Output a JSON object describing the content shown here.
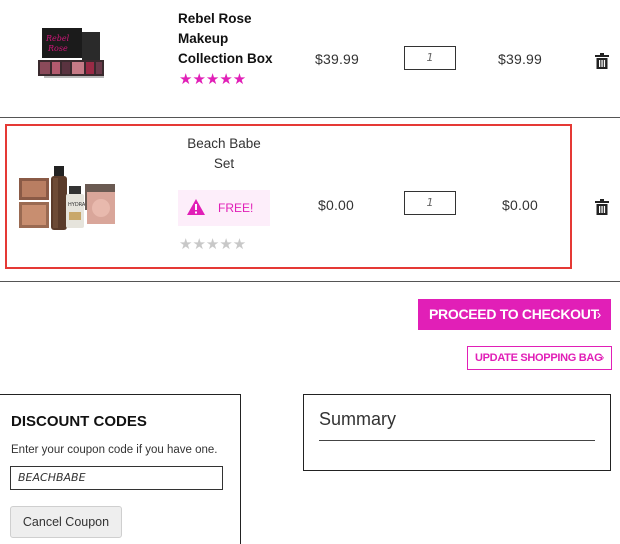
{
  "cart": {
    "items": [
      {
        "name": "Rebel Rose Makeup Collection Box",
        "name_lines": [
          "Rebel Rose",
          "Makeup",
          "Collection Box"
        ],
        "unit_price": "$39.99",
        "quantity": "1",
        "total": "$39.99",
        "rating": 5,
        "stars": "★★★★★",
        "image_icon": "makeup-box-thumbnail",
        "remove_icon": "trash-icon"
      },
      {
        "name": "Beach Babe Set",
        "name_lines": [
          "Beach Babe",
          "Set"
        ],
        "badge": "FREE!",
        "badge_icon": "warning-triangle-icon",
        "unit_price": "$0.00",
        "quantity": "1",
        "total": "$0.00",
        "rating": 0,
        "stars": "★★★★★",
        "image_icon": "beach-babe-set-thumbnail",
        "remove_icon": "trash-icon"
      }
    ]
  },
  "actions": {
    "checkout_label": "PROCEED TO CHECKOUT",
    "update_label": "UPDATE SHOPPING BAG",
    "chevron": "›"
  },
  "discount": {
    "title": "DISCOUNT CODES",
    "help": "Enter your coupon code if you have one.",
    "code_value": "BEACHBABE",
    "cancel_label": "Cancel Coupon"
  },
  "summary": {
    "title": "Summary"
  },
  "colors": {
    "brand_pink": "#e11fb7",
    "highlight_red": "#e53935",
    "free_bg": "#fdeefa"
  }
}
